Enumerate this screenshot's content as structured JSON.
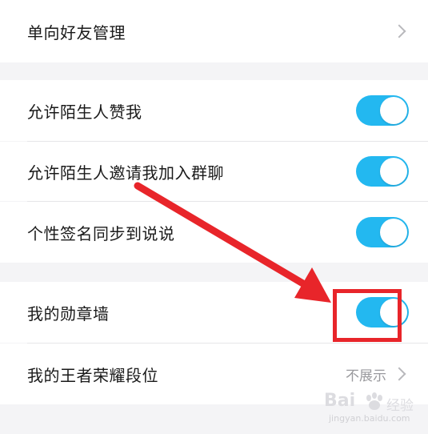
{
  "settings": {
    "group1": [
      {
        "label": "单向好友管理",
        "control": "chevron"
      }
    ],
    "group2": [
      {
        "label": "允许陌生人赞我",
        "control": "toggle",
        "state": "on"
      },
      {
        "label": "允许陌生人邀请我加入群聊",
        "control": "toggle",
        "state": "on"
      },
      {
        "label": "个性签名同步到说说",
        "control": "toggle",
        "state": "on"
      }
    ],
    "group3": [
      {
        "label": "我的勋章墙",
        "control": "toggle",
        "state": "on"
      },
      {
        "label": "我的王者荣耀段位",
        "control": "value-chevron",
        "value": "不展示"
      }
    ]
  },
  "colors": {
    "toggle_on": "#23b8f0",
    "annotation": "#e8252a"
  },
  "watermark": {
    "brand": "Bai",
    "suffix": "经验",
    "url": "jingyan.baidu.com"
  }
}
